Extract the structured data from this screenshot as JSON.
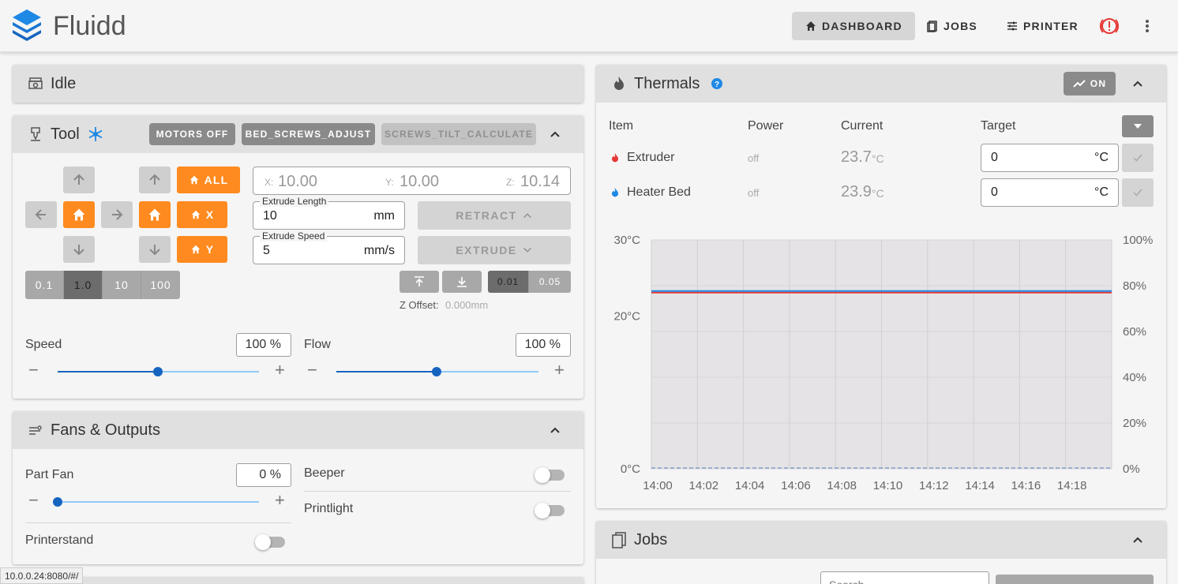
{
  "app": {
    "brand": "Fluidd",
    "status_url": "10.0.0.24:8080/#/"
  },
  "nav": {
    "dashboard": "DASHBOARD",
    "jobs": "JOBS",
    "printer": "PRINTER"
  },
  "colors": {
    "accent": "#ff8a1f",
    "primary": "#1565c0",
    "extruder": "#e53935",
    "bed": "#1e88e5"
  },
  "idle": {
    "title": "Idle"
  },
  "tool": {
    "title": "Tool",
    "buttons": {
      "motors_off": "MOTORS OFF",
      "bed_screws": "BED_SCREWS_ADJUST",
      "screws_tilt": "SCREWS_TILT_CALCULATE"
    },
    "home_all": "ALL",
    "home_x": "X",
    "home_y": "Y",
    "steps": [
      "0.1",
      "1.0",
      "10",
      "100"
    ],
    "position": {
      "x_label": "X:",
      "x": "10.00",
      "y_label": "Y:",
      "y": "10.00",
      "z_label": "Z:",
      "z": "10.14"
    },
    "extrude_length": {
      "label": "Extrude Length",
      "value": "10",
      "unit": "mm"
    },
    "extrude_speed": {
      "label": "Extrude Speed",
      "value": "5",
      "unit": "mm/s"
    },
    "retract": "RETRACT",
    "extrude": "EXTRUDE",
    "z_steps": [
      "0.01",
      "0.05"
    ],
    "z_offset_label": "Z Offset:",
    "z_offset": "0.000mm",
    "speed": {
      "label": "Speed",
      "value": "100 %",
      "level": 0.5
    },
    "flow": {
      "label": "Flow",
      "value": "100 %",
      "level": 0.5
    }
  },
  "fans": {
    "title": "Fans & Outputs",
    "part_fan": {
      "label": "Part Fan",
      "value": "0 %",
      "level": 0
    },
    "beeper": "Beeper",
    "printlight": "Printlight",
    "printerstand": "Printerstand"
  },
  "thermals": {
    "title": "Thermals",
    "on_label": "ON",
    "headers": {
      "item": "Item",
      "power": "Power",
      "current": "Current",
      "target": "Target"
    },
    "rows": [
      {
        "name": "Extruder",
        "power": "off",
        "current": "23.7",
        "unit": "°C",
        "target": "0",
        "target_unit": "°C"
      },
      {
        "name": "Heater Bed",
        "power": "off",
        "current": "23.9",
        "unit": "°C",
        "target": "0",
        "target_unit": "°C"
      }
    ]
  },
  "chart_data": {
    "type": "line",
    "x": [
      "14:00",
      "14:02",
      "14:04",
      "14:06",
      "14:08",
      "14:10",
      "14:12",
      "14:14",
      "14:16",
      "14:18"
    ],
    "y_left_ticks": [
      "30°C",
      "20°C",
      "0°C"
    ],
    "y_right_ticks": [
      "100%",
      "80%",
      "60%",
      "40%",
      "20%",
      "0%"
    ],
    "ylim": [
      0,
      30
    ],
    "series": [
      {
        "name": "Extruder",
        "color": "#e53935",
        "values": [
          23.7,
          23.7,
          23.7,
          23.7,
          23.7,
          23.7,
          23.7,
          23.7,
          23.7,
          23.7
        ]
      },
      {
        "name": "Heater Bed",
        "color": "#1e88e5",
        "values": [
          23.9,
          23.9,
          23.9,
          23.9,
          23.9,
          23.9,
          23.9,
          23.9,
          23.9,
          23.9
        ]
      }
    ]
  },
  "jobs": {
    "title": "Jobs",
    "search_placeholder": "Search"
  }
}
